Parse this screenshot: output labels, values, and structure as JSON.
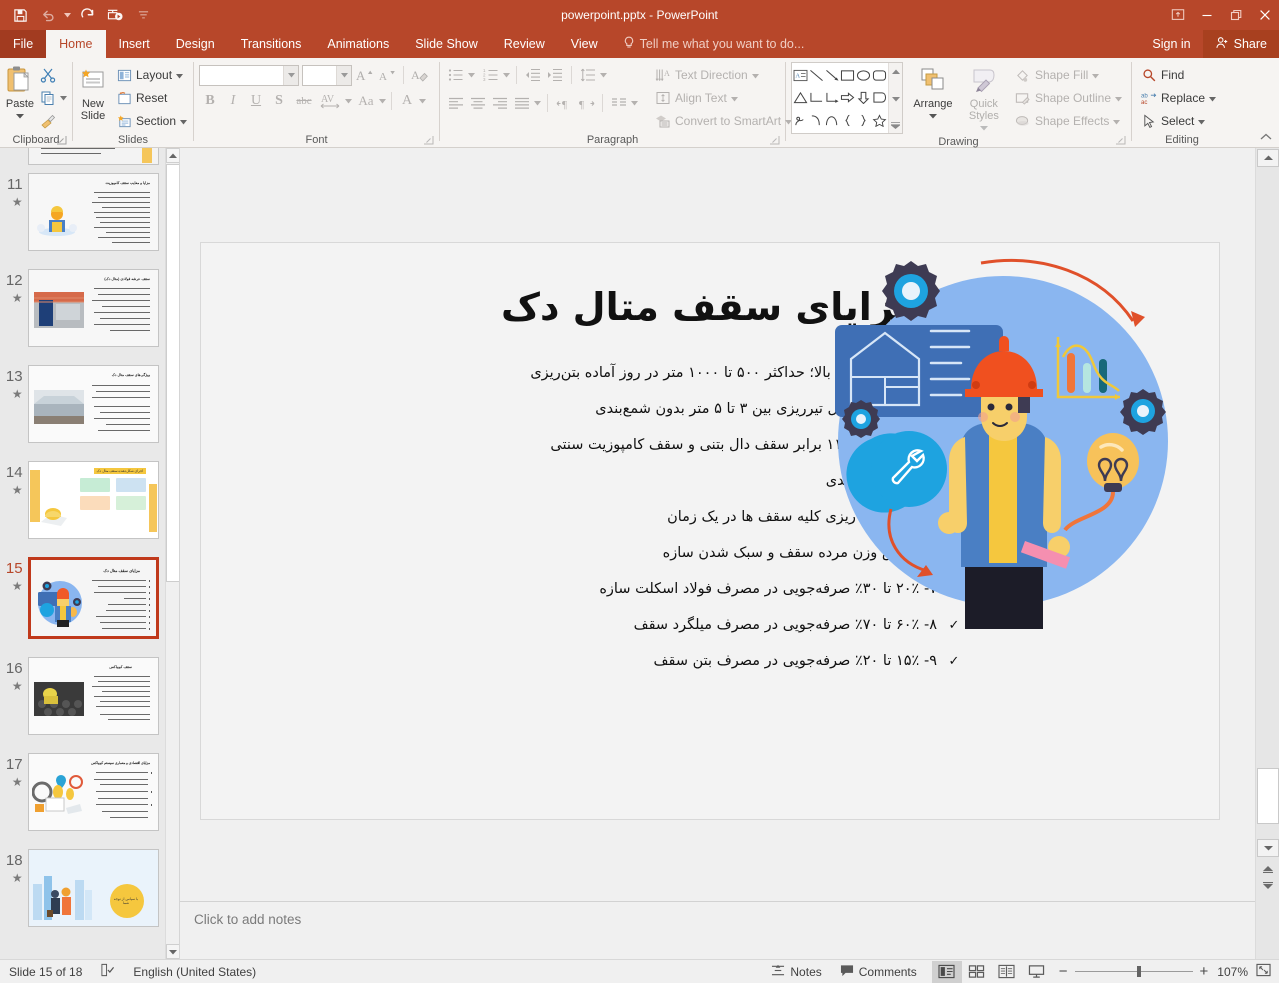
{
  "window": {
    "title": "powerpoint.pptx - PowerPoint",
    "quick_access": [
      "save-icon",
      "undo-icon",
      "redo-icon",
      "start-presentation-icon",
      "customize-qat-icon"
    ],
    "controls": [
      "ribbon-display-options-icon",
      "minimize-icon",
      "restore-icon",
      "close-icon"
    ]
  },
  "tabs": {
    "file": "File",
    "items": [
      "Home",
      "Insert",
      "Design",
      "Transitions",
      "Animations",
      "Slide Show",
      "Review",
      "View"
    ],
    "active": "Home",
    "tell_me": "Tell me what you want to do...",
    "sign_in": "Sign in",
    "share": "Share"
  },
  "ribbon": {
    "clipboard": {
      "label": "Clipboard",
      "paste": "Paste",
      "cut": "cut-icon",
      "copy": "copy-icon",
      "format_painter": "format-painter-icon"
    },
    "slides": {
      "label": "Slides",
      "new_slide": "New Slide",
      "layout": "Layout",
      "reset": "Reset",
      "section": "Section"
    },
    "font": {
      "label": "Font",
      "font_name": "",
      "font_size": "",
      "font_name_placeholder": "",
      "font_size_placeholder": "",
      "increase_size": "A",
      "decrease_size": "A",
      "clear_formatting": "clear-formatting-icon",
      "bold": "B",
      "italic": "I",
      "underline": "U",
      "shadow": "S",
      "strikethrough": "abc",
      "character_spacing": "AV",
      "change_case": "Aa",
      "font_color": "A"
    },
    "paragraph": {
      "label": "Paragraph",
      "bullets": "bullets-icon",
      "numbering": "numbering-icon",
      "decrease_indent": "decrease-indent-icon",
      "increase_indent": "increase-indent-icon",
      "line_spacing": "line-spacing-icon",
      "align_left": "align-left-icon",
      "align_center": "align-center-icon",
      "align_right": "align-right-icon",
      "justify": "justify-icon",
      "ltr": "left-to-right-icon",
      "rtl": "right-to-left-icon",
      "columns": "columns-icon",
      "text_direction": "Text Direction",
      "align_text": "Align Text",
      "convert_smartart": "Convert to SmartArt"
    },
    "drawing": {
      "label": "Drawing",
      "arrange": "Arrange",
      "quick_styles": "Quick Styles",
      "shape_fill": "Shape Fill",
      "shape_outline": "Shape Outline",
      "shape_effects": "Shape Effects",
      "shapes": [
        "textbox",
        "line",
        "arrow",
        "rectangle",
        "oval",
        "rounded-rectangle",
        "triangle",
        "elbow-connector",
        "elbow-arrow-connector",
        "right-arrow",
        "down-arrow",
        "pentagon",
        "freeform",
        "curve",
        "arc",
        "left-brace",
        "right-brace",
        "star"
      ]
    },
    "editing": {
      "label": "Editing",
      "find": "Find",
      "replace": "Replace",
      "select": "Select"
    },
    "collapse": "collapse-ribbon-icon"
  },
  "slide_panel": {
    "thumbnails": [
      {
        "number": "10",
        "title": "",
        "layout": "text-left-accent-right",
        "partial": true
      },
      {
        "number": "11",
        "title": "مزایا و معایب سقف کامپوزیت",
        "layout": "text-left-image-right",
        "image": "engineer-illustration"
      },
      {
        "number": "12",
        "title": "سقف عرشه فولادی (متال دک)",
        "layout": "text-left-image-right",
        "image": "steel-structure-photo"
      },
      {
        "number": "13",
        "title": "ویژگی‌های سقف متال دک",
        "layout": "text-left-image-right",
        "image": "metal-deck-photo"
      },
      {
        "number": "14",
        "title": "اجرای شکل‌دهنده سقف متال دک",
        "layout": "diagram",
        "image": "flowchart-hardhat"
      },
      {
        "number": "15",
        "title": "مزایای سقف متال دک",
        "layout": "text-left-image-right",
        "image": "engineer-circle-illustration",
        "selected": true
      },
      {
        "number": "16",
        "title": "سقف کوبیاکس",
        "layout": "text-left-image-right",
        "image": "cobiax-photo"
      },
      {
        "number": "17",
        "title": "مزایای اقتصادی و معماری سیستم کوبیاکس",
        "layout": "text-left-image-right",
        "image": "business-illustration"
      },
      {
        "number": "18",
        "title": "با سپاس از توجه شما",
        "layout": "closing",
        "image": "thankyou-illustration"
      }
    ]
  },
  "slide": {
    "title": "مزایای سقف متال دک",
    "check_mark": "✓",
    "bullets": [
      "۱- سرعت اجرای بالا؛ حداکثر ۵۰۰ تا ۱۰۰۰ متر در روز آماده بتن‌ریزی",
      "۲- افزایش فواصل تیرریزی بین ۳ تا ۵ متر بدون شمع‌بندی",
      "۳- سرعت اجرا ۱۱ برابر سقف دال بتنی و سقف کامپوزیت سنتی",
      "۴- حذف قالب‌بندی",
      "۵- امکان بتن ریزی کلیه سقف ها در یک زمان",
      "۶- کاهش وزن مرده سقف و سبک شدن سازه",
      "۷- ۲۰٪ تا ۳۰٪ صرفه‌جویی در مصرف فولاد اسکلت سازه",
      "۸- ۶۰٪ تا ۷۰٪ صرفه‌جویی در مصرف میلگرد سقف",
      "۹- ۱۵٪ تا ۲۰٪ صرفه‌جویی در مصرف بتن سقف"
    ],
    "illustration": "construction-worker-gears-lightbulb-illustration"
  },
  "notes": {
    "placeholder": "Click to add notes"
  },
  "status": {
    "slide_counter": "Slide 15 of 18",
    "spellcheck_icon": "spellcheck-icon",
    "language": "English (United States)",
    "notes_button": "Notes",
    "comments_button": "Comments",
    "views": [
      "normal-view-icon",
      "slide-sorter-icon",
      "reading-view-icon",
      "slideshow-icon"
    ],
    "active_view": "normal-view-icon",
    "zoom_out": "−",
    "zoom_in": "+",
    "zoom_level": "107%",
    "fit_slide": "fit-to-window-icon"
  },
  "colors": {
    "brand": "#b7472a",
    "brand_dark": "#a23b20",
    "ribbon_bg": "#f6f4f2",
    "selection": "#c0391b",
    "slide_bg": "#f3f3f3",
    "illus_circle": "#8ab6f0"
  }
}
